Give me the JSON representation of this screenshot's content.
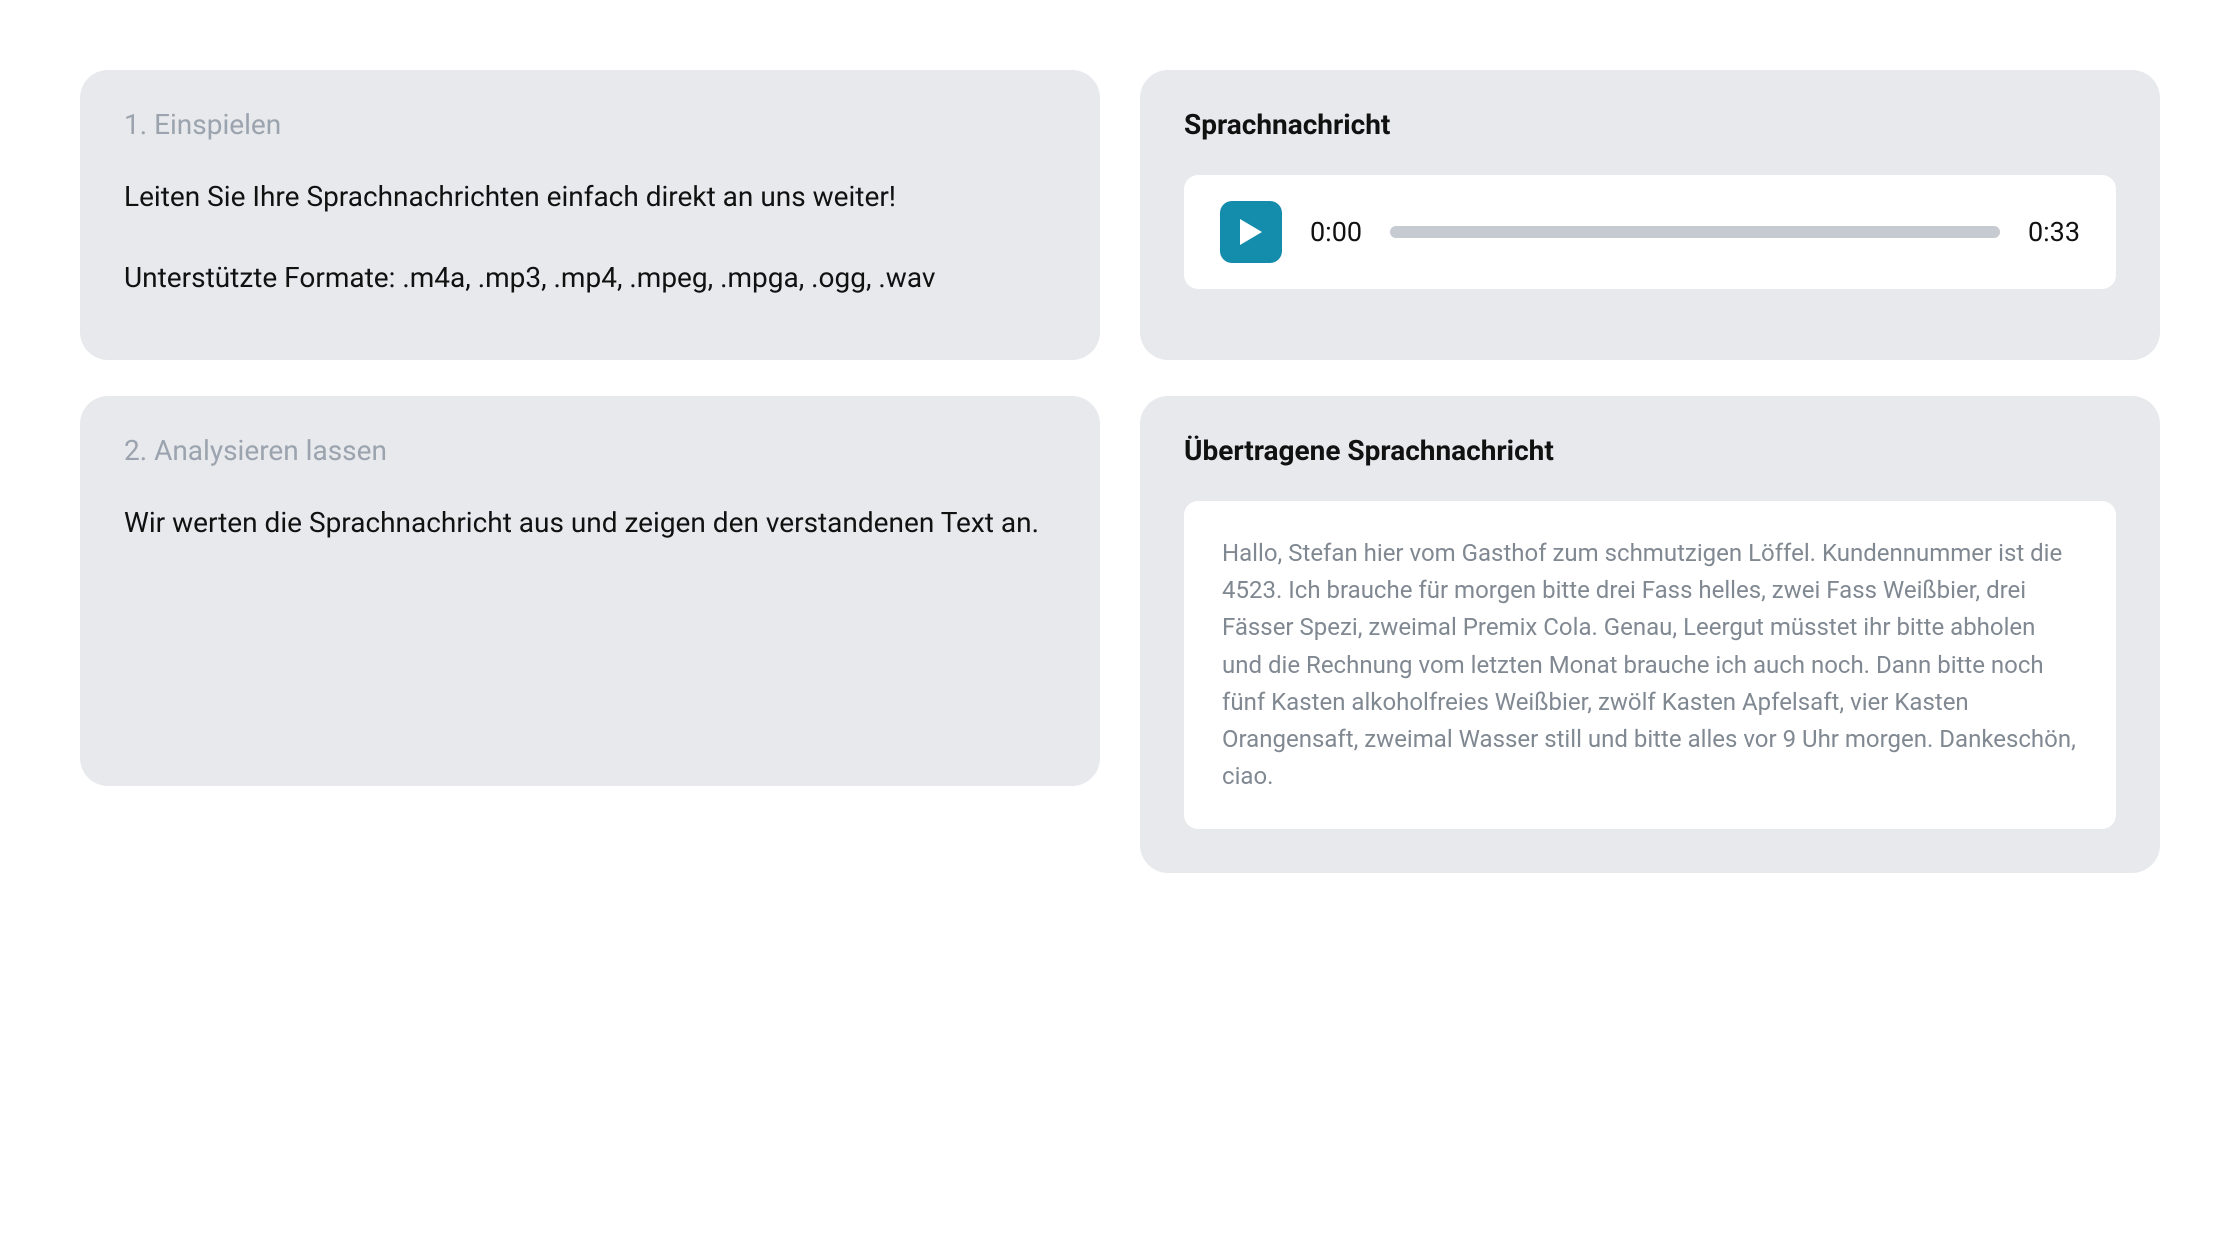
{
  "steps": [
    {
      "number": "1.",
      "title": "Einspielen",
      "body_line1": "Leiten Sie Ihre Sprachnachrichten einfach direkt an uns weiter!",
      "body_line2": "Unterstützte Formate: .m4a, .mp3, .mp4, .mpeg, .mpga, .ogg, .wav"
    },
    {
      "number": "2.",
      "title": "Analysieren lassen",
      "body_line1": "Wir werten die Sprachnachricht aus und zeigen den verstandenen Text an.",
      "body_line2": ""
    }
  ],
  "audio": {
    "title": "Sprachnachricht",
    "current_time": "0:00",
    "duration": "0:33"
  },
  "transcript": {
    "title": "Übertragene Sprachnachricht",
    "text": "Hallo, Stefan hier vom Gasthof zum schmutzigen Löffel. Kundennummer ist die 4523. Ich brauche für morgen bitte drei Fass helles, zwei Fass Weißbier, drei Fässer Spezi, zweimal Premix Cola. Genau, Leergut müsstet ihr bitte abholen und die Rechnung vom letzten Monat brauche ich auch noch. Dann bitte noch fünf Kasten alkoholfreies Weißbier, zwölf Kasten Apfelsaft, vier Kasten Orangensaft, zweimal Wasser still und bitte alles vor 9 Uhr morgen. Dankeschön, ciao."
  },
  "colors": {
    "card_bg": "#e7e9ec",
    "accent": "#148cac",
    "muted_text": "#9ba3ae",
    "transcript_text": "#808892"
  }
}
